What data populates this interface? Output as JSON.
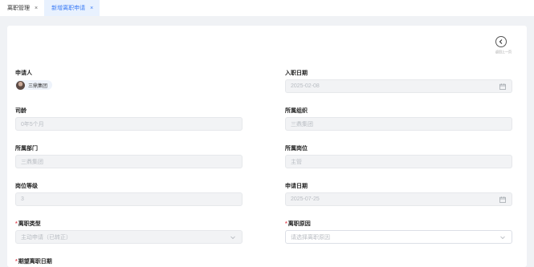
{
  "tabs": [
    {
      "label": "离职管理",
      "close": "×"
    },
    {
      "label": "新增离职申请",
      "close": "×"
    }
  ],
  "back": {
    "label": "返回上一页"
  },
  "form": {
    "applicant": {
      "label": "申请人",
      "name": "三鼎集团"
    },
    "entry_date": {
      "label": "入职日期",
      "value": "2025-02-08"
    },
    "seniority": {
      "label": "司龄",
      "value": "0年5个月"
    },
    "org": {
      "label": "所属组织",
      "value": "三鼎集团"
    },
    "dept": {
      "label": "所属部门",
      "value": "三鼎集团"
    },
    "position": {
      "label": "所属岗位",
      "value": "主管"
    },
    "level": {
      "label": "岗位等级",
      "value": "3"
    },
    "apply_date": {
      "label": "申请日期",
      "value": "2025-07-25"
    },
    "resign_type": {
      "label": "离职类型",
      "value": "主动申请（已转正）",
      "required": "*"
    },
    "resign_reason": {
      "label": "离职原因",
      "placeholder": "请选择离职原因",
      "required": "*"
    },
    "expected_date": {
      "label": "期望离职日期",
      "required": "*"
    }
  }
}
